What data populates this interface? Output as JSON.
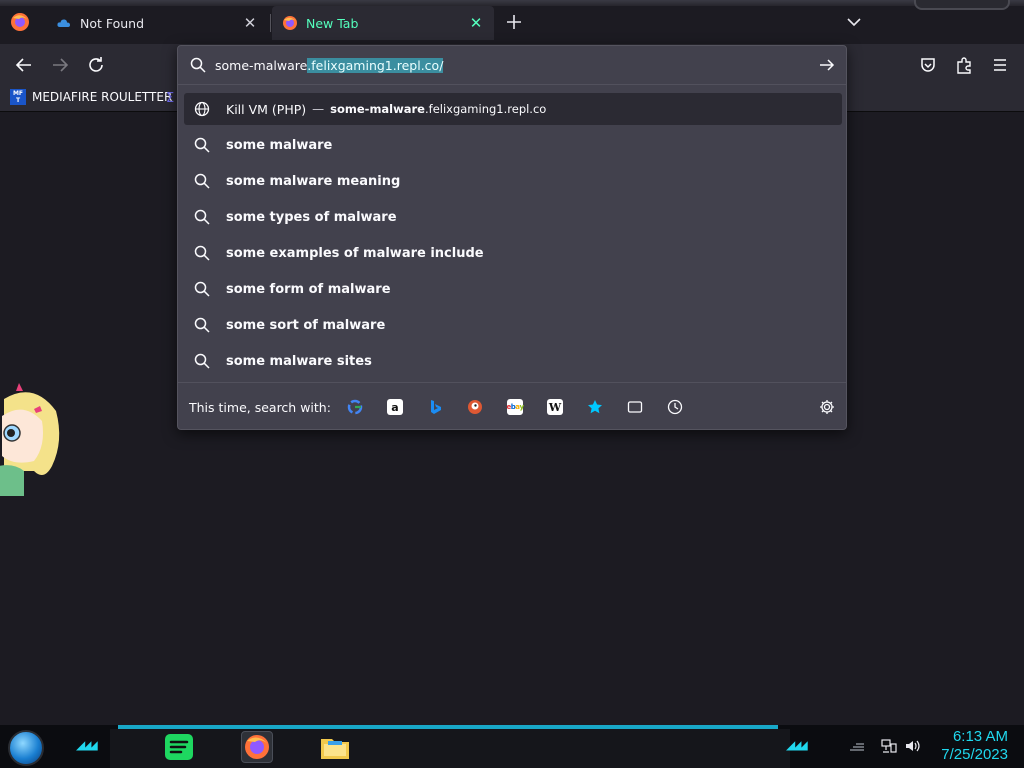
{
  "tabs": [
    {
      "title": "Not Found",
      "active": false
    },
    {
      "title": "New Tab",
      "active": true
    }
  ],
  "urlbar": {
    "typed": "some-malware",
    "autofill": ".felixgaming1.repl.co/"
  },
  "bookmarks": [
    {
      "label": "MEDIAFIRE ROULETTER",
      "icon_text": "MF T"
    }
  ],
  "first_result": {
    "title": "Kill VM (PHP)",
    "separator": "—",
    "url_bold": "some-malware",
    "url_rest": ".felixgaming1.repl.co"
  },
  "suggestions": [
    "some malware",
    "some malware meaning",
    "some types of malware",
    "some examples of malware include",
    "some form of malware",
    "some sort of malware",
    "some malware sites"
  ],
  "one_off": {
    "label": "This time, search with:",
    "engines": [
      "google-icon",
      "amazon-icon",
      "bing-icon",
      "duckduckgo-icon",
      "ebay-icon",
      "wikipedia-icon",
      "bookmarks-star-icon",
      "tabs-icon",
      "history-icon"
    ]
  },
  "taskbar": {
    "time": "6:13 AM",
    "date": "7/25/2023"
  },
  "colors": {
    "accent": "#54ffbd",
    "clock": "#20d8ee",
    "selection": "#3b8ea0"
  }
}
